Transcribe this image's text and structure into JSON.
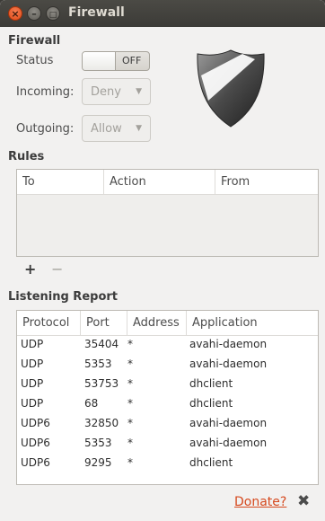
{
  "window": {
    "title": "Firewall"
  },
  "firewall": {
    "heading": "Firewall",
    "status_label": "Status",
    "status_value": "OFF",
    "incoming_label": "Incoming:",
    "incoming_value": "Deny",
    "outgoing_label": "Outgoing:",
    "outgoing_value": "Allow"
  },
  "rules": {
    "heading": "Rules",
    "columns": [
      "To",
      "Action",
      "From"
    ],
    "add_label": "+",
    "remove_label": "−"
  },
  "report": {
    "heading": "Listening Report",
    "columns": [
      "Protocol",
      "Port",
      "Address",
      "Application"
    ],
    "rows": [
      {
        "protocol": "UDP",
        "port": "35404",
        "address": "*",
        "application": "avahi-daemon"
      },
      {
        "protocol": "UDP",
        "port": "5353",
        "address": "*",
        "application": "avahi-daemon"
      },
      {
        "protocol": "UDP",
        "port": "53753",
        "address": "*",
        "application": "dhclient"
      },
      {
        "protocol": "UDP",
        "port": "68",
        "address": "*",
        "application": "dhclient"
      },
      {
        "protocol": "UDP6",
        "port": "32850",
        "address": "*",
        "application": "avahi-daemon"
      },
      {
        "protocol": "UDP6",
        "port": "5353",
        "address": "*",
        "application": "avahi-daemon"
      },
      {
        "protocol": "UDP6",
        "port": "9295",
        "address": "*",
        "application": "dhclient"
      }
    ]
  },
  "footer": {
    "donate_label": "Donate?",
    "close_symbol": "✖"
  },
  "icons": {
    "close": "close-icon",
    "minimize": "minimize-icon",
    "maximize": "maximize-icon",
    "shield": "shield-icon"
  },
  "colors": {
    "accent": "#df4a16",
    "link": "#d6491e",
    "titlebar": "#3c3b37",
    "window_bg": "#f2f1f0"
  }
}
